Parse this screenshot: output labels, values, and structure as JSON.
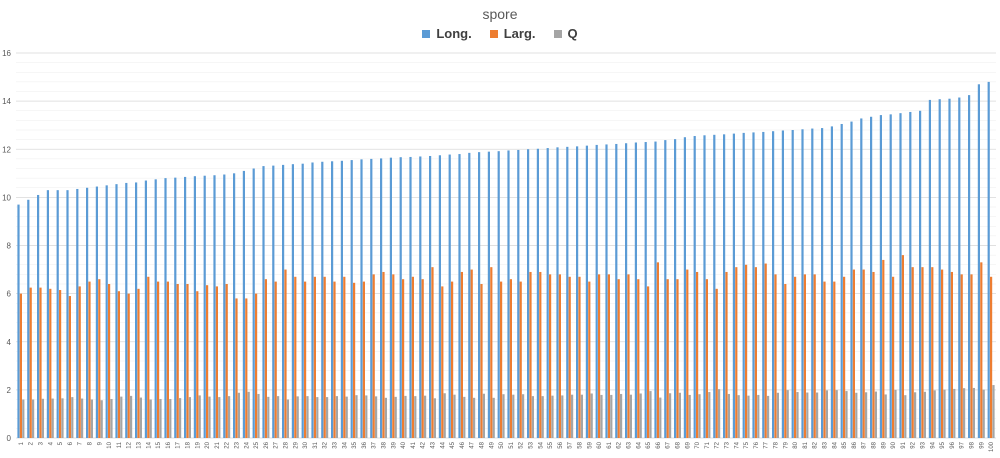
{
  "chart_data": {
    "type": "bar",
    "title": "spore",
    "legend_position": "top",
    "grid": true,
    "ylim": [
      0,
      16
    ],
    "yticks": [
      0,
      2,
      4,
      6,
      8,
      10,
      12,
      14,
      16
    ],
    "categories": [
      "1",
      "2",
      "3",
      "4",
      "5",
      "6",
      "7",
      "8",
      "9",
      "10",
      "11",
      "12",
      "13",
      "14",
      "15",
      "16",
      "17",
      "18",
      "19",
      "20",
      "21",
      "22",
      "23",
      "24",
      "25",
      "26",
      "27",
      "28",
      "29",
      "30",
      "31",
      "32",
      "33",
      "34",
      "35",
      "36",
      "37",
      "38",
      "39",
      "40",
      "41",
      "42",
      "43",
      "44",
      "45",
      "46",
      "47",
      "48",
      "49",
      "50",
      "51",
      "52",
      "53",
      "54",
      "55",
      "56",
      "57",
      "58",
      "59",
      "60",
      "61",
      "62",
      "63",
      "64",
      "65",
      "66",
      "67",
      "68",
      "69",
      "70",
      "71",
      "72",
      "73",
      "74",
      "75",
      "76",
      "77",
      "78",
      "79",
      "80",
      "81",
      "82",
      "83",
      "84",
      "85",
      "86",
      "87",
      "88",
      "89",
      "90",
      "91",
      "92",
      "93",
      "94",
      "95",
      "96",
      "97",
      "98",
      "99",
      "100"
    ],
    "series": [
      {
        "name": "Long.",
        "color": "#5b9bd5",
        "values": [
          9.7,
          9.9,
          10.1,
          10.3,
          10.3,
          10.3,
          10.35,
          10.4,
          10.45,
          10.5,
          10.55,
          10.6,
          10.62,
          10.7,
          10.75,
          10.8,
          10.82,
          10.85,
          10.88,
          10.9,
          10.92,
          10.95,
          11.0,
          11.1,
          11.2,
          11.3,
          11.32,
          11.35,
          11.38,
          11.4,
          11.45,
          11.48,
          11.5,
          11.52,
          11.55,
          11.58,
          11.6,
          11.62,
          11.65,
          11.67,
          11.68,
          11.7,
          11.72,
          11.75,
          11.78,
          11.8,
          11.85,
          11.88,
          11.9,
          11.92,
          11.95,
          11.97,
          12.0,
          12.02,
          12.05,
          12.08,
          12.1,
          12.12,
          12.15,
          12.18,
          12.2,
          12.22,
          12.25,
          12.28,
          12.3,
          12.32,
          12.38,
          12.42,
          12.5,
          12.55,
          12.58,
          12.6,
          12.62,
          12.65,
          12.68,
          12.7,
          12.72,
          12.75,
          12.78,
          12.8,
          12.83,
          12.86,
          12.88,
          12.95,
          13.05,
          13.15,
          13.28,
          13.35,
          13.42,
          13.45,
          13.5,
          13.55,
          13.6,
          14.05,
          14.08,
          14.1,
          14.15,
          14.25,
          14.7,
          14.8
        ]
      },
      {
        "name": "Larg.",
        "color": "#ed7d31",
        "values": [
          6.0,
          6.25,
          6.25,
          6.2,
          6.15,
          5.9,
          6.3,
          6.5,
          6.6,
          6.4,
          6.1,
          6.0,
          6.2,
          6.7,
          6.5,
          6.5,
          6.4,
          6.4,
          6.1,
          6.35,
          6.3,
          6.4,
          5.8,
          5.8,
          6.0,
          6.6,
          6.5,
          7.0,
          6.7,
          6.5,
          6.7,
          6.7,
          6.5,
          6.7,
          6.45,
          6.5,
          6.8,
          6.9,
          6.8,
          6.6,
          6.7,
          6.6,
          7.1,
          6.3,
          6.5,
          6.9,
          7.0,
          6.4,
          7.1,
          6.5,
          6.6,
          6.5,
          6.9,
          6.9,
          6.8,
          6.8,
          6.7,
          6.7,
          6.5,
          6.8,
          6.8,
          6.6,
          6.8,
          6.6,
          6.3,
          7.3,
          6.6,
          6.6,
          7.0,
          6.9,
          6.6,
          6.2,
          6.9,
          7.1,
          7.2,
          7.1,
          7.25,
          6.8,
          6.4,
          6.7,
          6.8,
          6.8,
          6.5,
          6.5,
          6.7,
          7.0,
          7.0,
          6.9,
          7.4,
          6.7,
          7.6,
          7.1,
          7.1,
          7.1,
          7.0,
          6.9,
          6.8,
          6.8,
          7.3,
          6.7
        ]
      },
      {
        "name": "Q",
        "color": "#a5a5a5",
        "values": [
          1.6,
          1.6,
          1.63,
          1.64,
          1.65,
          1.7,
          1.64,
          1.6,
          1.57,
          1.62,
          1.72,
          1.75,
          1.68,
          1.6,
          1.62,
          1.62,
          1.66,
          1.7,
          1.77,
          1.72,
          1.7,
          1.74,
          1.88,
          1.92,
          1.83,
          1.71,
          1.74,
          1.6,
          1.73,
          1.74,
          1.7,
          1.7,
          1.74,
          1.72,
          1.78,
          1.77,
          1.73,
          1.67,
          1.71,
          1.75,
          1.74,
          1.76,
          1.65,
          1.86,
          1.8,
          1.71,
          1.67,
          1.84,
          1.67,
          1.82,
          1.8,
          1.82,
          1.74,
          1.74,
          1.76,
          1.77,
          1.8,
          1.8,
          1.85,
          1.79,
          1.79,
          1.83,
          1.8,
          1.85,
          1.95,
          1.68,
          1.86,
          1.88,
          1.79,
          1.82,
          1.91,
          2.03,
          1.83,
          1.78,
          1.76,
          1.79,
          1.75,
          1.88,
          1.99,
          1.91,
          1.89,
          1.89,
          1.98,
          1.99,
          1.95,
          1.88,
          1.9,
          1.93,
          1.81,
          2.0,
          1.78,
          1.9,
          1.92,
          1.98,
          2.01,
          2.04,
          2.07,
          2.08,
          2.01,
          2.2
        ]
      }
    ]
  }
}
